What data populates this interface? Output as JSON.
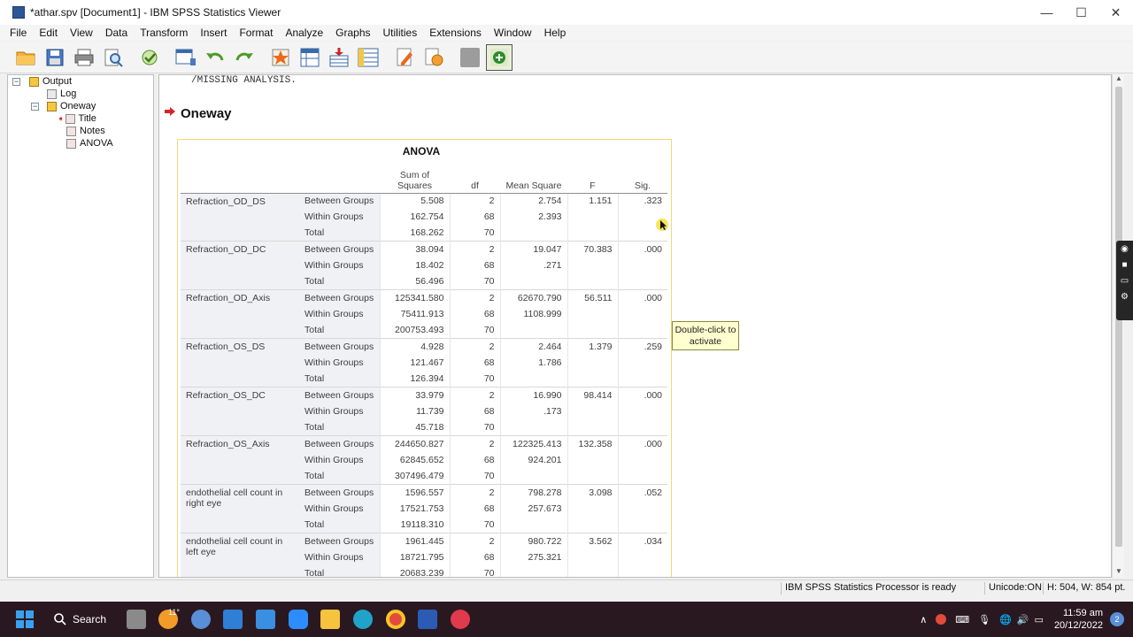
{
  "window": {
    "title": "*athar.spv [Document1] - IBM SPSS Statistics Viewer",
    "minimize": "—",
    "maximize": "☐",
    "close": "✕"
  },
  "menu": [
    "File",
    "Edit",
    "View",
    "Data",
    "Transform",
    "Insert",
    "Format",
    "Analyze",
    "Graphs",
    "Utilities",
    "Extensions",
    "Window",
    "Help"
  ],
  "toolbar": {
    "icons": [
      "open-folder-icon",
      "save-icon",
      "print-icon",
      "print-preview-icon",
      "export-icon",
      "recall-dialog-icon",
      "undo-icon",
      "redo-icon",
      "goto-case-icon",
      "goto-variable-icon",
      "insert-cases-icon",
      "variables-icon",
      "insert-heading-icon",
      "insert-title-icon",
      "disabled-icon",
      "add-output-icon"
    ]
  },
  "outline": {
    "items": [
      {
        "label": "Output",
        "level": 0,
        "icon": "output-book-icon"
      },
      {
        "label": "Log",
        "level": 1,
        "icon": "log-icon"
      },
      {
        "label": "Oneway",
        "level": 1,
        "icon": "procedure-book-icon"
      },
      {
        "label": "Title",
        "level": 2,
        "icon": "title-icon"
      },
      {
        "label": "Notes",
        "level": 2,
        "icon": "notes-icon"
      },
      {
        "label": "ANOVA",
        "level": 2,
        "icon": "table-icon"
      }
    ]
  },
  "viewer": {
    "syntax_line": "/MISSING ANALYSIS.",
    "heading": "Oneway",
    "table_title": "ANOVA",
    "columns": [
      "",
      "",
      "Sum of Squares",
      "df",
      "Mean Square",
      "F",
      "Sig."
    ],
    "rows": [
      {
        "variable": "Refraction_OD_DS",
        "rows": [
          [
            "Between Groups",
            "5.508",
            "2",
            "2.754",
            "1.151",
            ".323"
          ],
          [
            "Within Groups",
            "162.754",
            "68",
            "2.393",
            "",
            ""
          ],
          [
            "Total",
            "168.262",
            "70",
            "",
            "",
            ""
          ]
        ]
      },
      {
        "variable": "Refraction_OD_DC",
        "rows": [
          [
            "Between Groups",
            "38.094",
            "2",
            "19.047",
            "70.383",
            ".000"
          ],
          [
            "Within Groups",
            "18.402",
            "68",
            ".271",
            "",
            ""
          ],
          [
            "Total",
            "56.496",
            "70",
            "",
            "",
            ""
          ]
        ]
      },
      {
        "variable": "Refraction_OD_Axis",
        "rows": [
          [
            "Between Groups",
            "125341.580",
            "2",
            "62670.790",
            "56.511",
            ".000"
          ],
          [
            "Within Groups",
            "75411.913",
            "68",
            "1108.999",
            "",
            ""
          ],
          [
            "Total",
            "200753.493",
            "70",
            "",
            "",
            ""
          ]
        ]
      },
      {
        "variable": "Refraction_OS_DS",
        "rows": [
          [
            "Between Groups",
            "4.928",
            "2",
            "2.464",
            "1.379",
            ".259"
          ],
          [
            "Within Groups",
            "121.467",
            "68",
            "1.786",
            "",
            ""
          ],
          [
            "Total",
            "126.394",
            "70",
            "",
            "",
            ""
          ]
        ]
      },
      {
        "variable": "Refraction_OS_DC",
        "rows": [
          [
            "Between Groups",
            "33.979",
            "2",
            "16.990",
            "98.414",
            ".000"
          ],
          [
            "Within Groups",
            "11.739",
            "68",
            ".173",
            "",
            ""
          ],
          [
            "Total",
            "45.718",
            "70",
            "",
            "",
            ""
          ]
        ]
      },
      {
        "variable": "Refraction_OS_Axis",
        "rows": [
          [
            "Between Groups",
            "244650.827",
            "2",
            "122325.413",
            "132.358",
            ".000"
          ],
          [
            "Within Groups",
            "62845.652",
            "68",
            "924.201",
            "",
            ""
          ],
          [
            "Total",
            "307496.479",
            "70",
            "",
            "",
            ""
          ]
        ]
      },
      {
        "variable": "endothelial cell count in right eye",
        "rows": [
          [
            "Between Groups",
            "1596.557",
            "2",
            "798.278",
            "3.098",
            ".052"
          ],
          [
            "Within Groups",
            "17521.753",
            "68",
            "257.673",
            "",
            ""
          ],
          [
            "Total",
            "19118.310",
            "70",
            "",
            "",
            ""
          ]
        ]
      },
      {
        "variable": "endothelial cell count in left eye",
        "rows": [
          [
            "Between Groups",
            "1961.445",
            "2",
            "980.722",
            "3.562",
            ".034"
          ],
          [
            "Within Groups",
            "18721.795",
            "68",
            "275.321",
            "",
            ""
          ],
          [
            "Total",
            "20683.239",
            "70",
            "",
            "",
            ""
          ]
        ]
      }
    ],
    "tooltip": "Double-click to activate"
  },
  "status": {
    "processor": "IBM SPSS Statistics Processor is ready",
    "unicode": "Unicode:ON",
    "dimensions": "H: 504, W: 854 pt."
  },
  "taskbar": {
    "search_label": "Search",
    "weather": "11°",
    "time": "11:59 am",
    "date": "20/12/2022",
    "notifications": "2"
  },
  "colors": {
    "accent_red": "#d9232a",
    "table_frame": "#f2d977",
    "tooltip_bg": "#ffffcf",
    "taskbar_bg": "#2a1820"
  }
}
